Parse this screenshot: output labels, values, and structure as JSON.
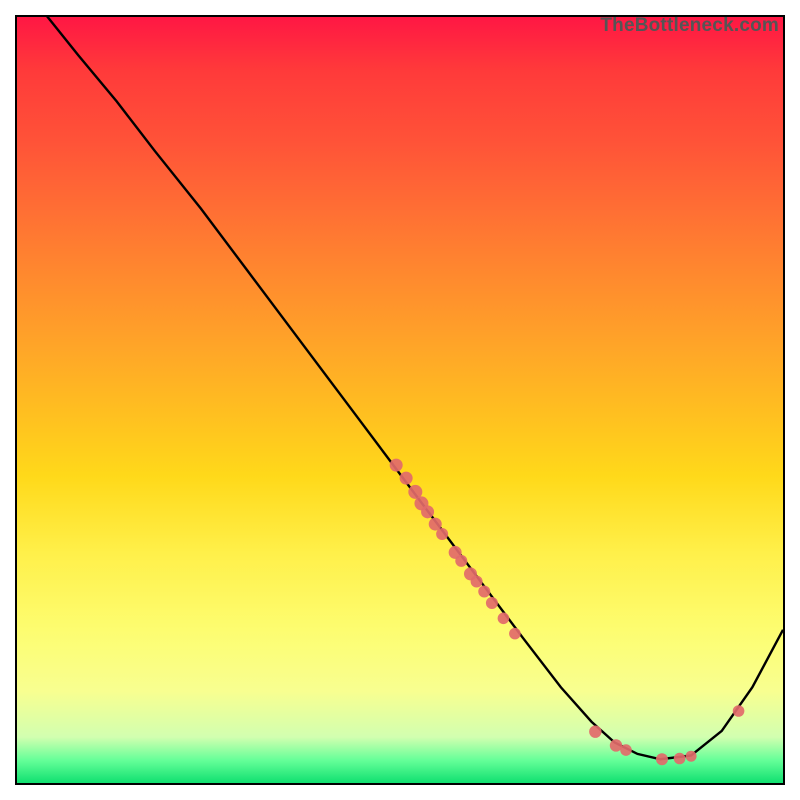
{
  "watermark": "TheBottleneck.com",
  "chart_data": {
    "type": "line",
    "title": "",
    "xlabel": "",
    "ylabel": "",
    "xlim": [
      0,
      100
    ],
    "ylim": [
      0,
      100
    ],
    "series": [
      {
        "name": "curve",
        "x": [
          0,
          4,
          8,
          13,
          18,
          24,
          30,
          36,
          42,
          48,
          54,
          60,
          66,
          71,
          75,
          78,
          81,
          84,
          88,
          92,
          96,
          100
        ],
        "y": [
          105,
          100,
          95,
          89,
          82.5,
          75,
          67,
          59,
          51,
          43,
          35,
          27,
          19,
          12.5,
          8,
          5.3,
          3.8,
          3.1,
          3.6,
          6.8,
          12.5,
          20
        ]
      }
    ],
    "markers": [
      {
        "x": 49.5,
        "y": 41.5,
        "r": 6.5
      },
      {
        "x": 50.8,
        "y": 39.8,
        "r": 6.5
      },
      {
        "x": 52.0,
        "y": 38.0,
        "r": 7.0
      },
      {
        "x": 52.8,
        "y": 36.5,
        "r": 7.0
      },
      {
        "x": 53.6,
        "y": 35.4,
        "r": 6.5
      },
      {
        "x": 54.6,
        "y": 33.8,
        "r": 6.5
      },
      {
        "x": 55.5,
        "y": 32.5,
        "r": 6.0
      },
      {
        "x": 57.2,
        "y": 30.1,
        "r": 6.5
      },
      {
        "x": 58.0,
        "y": 29.0,
        "r": 6.0
      },
      {
        "x": 59.2,
        "y": 27.3,
        "r": 6.5
      },
      {
        "x": 60.0,
        "y": 26.3,
        "r": 6.0
      },
      {
        "x": 61.0,
        "y": 25.0,
        "r": 6.0
      },
      {
        "x": 62.0,
        "y": 23.5,
        "r": 6.0
      },
      {
        "x": 63.5,
        "y": 21.5,
        "r": 5.8
      },
      {
        "x": 65.0,
        "y": 19.5,
        "r": 5.8
      },
      {
        "x": 75.5,
        "y": 6.7,
        "r": 6.2
      },
      {
        "x": 78.2,
        "y": 4.9,
        "r": 6.2
      },
      {
        "x": 79.5,
        "y": 4.3,
        "r": 5.8
      },
      {
        "x": 84.2,
        "y": 3.1,
        "r": 6.0
      },
      {
        "x": 86.5,
        "y": 3.2,
        "r": 5.8
      },
      {
        "x": 88.0,
        "y": 3.5,
        "r": 5.5
      },
      {
        "x": 94.2,
        "y": 9.4,
        "r": 5.8
      }
    ],
    "marker_color": "#e26a6a",
    "curve_color": "#000000"
  }
}
